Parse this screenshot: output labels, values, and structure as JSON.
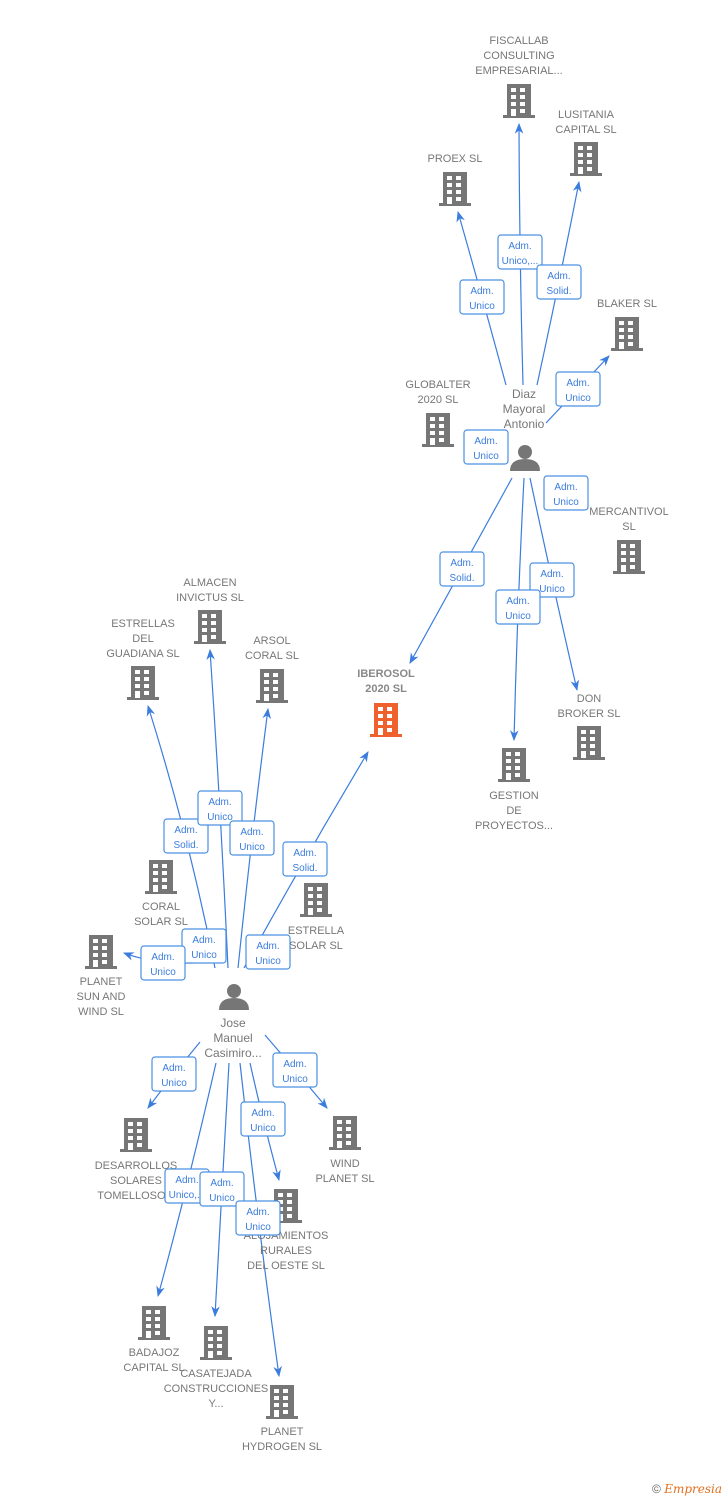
{
  "colors": {
    "edge": "#3b7ddd",
    "node": "#767676",
    "highlight": "#f0622d"
  },
  "hubs": [
    {
      "id": "diaz",
      "name": [
        "Diaz",
        "Mayoral",
        "Antonio"
      ],
      "icon": "person-icon"
    },
    {
      "id": "jose",
      "name": [
        "Jose",
        "Manuel",
        "Casimiro..."
      ],
      "icon": "person-icon"
    }
  ],
  "companies": [
    {
      "id": "fiscallab",
      "name": [
        "FISCALLAB",
        "CONSULTING",
        "EMPRESARIAL..."
      ]
    },
    {
      "id": "lusitania",
      "name": [
        "LUSITANIA",
        "CAPITAL  SL"
      ]
    },
    {
      "id": "proex",
      "name": [
        "PROEX  SL"
      ]
    },
    {
      "id": "blaker",
      "name": [
        "BLAKER  SL"
      ]
    },
    {
      "id": "globalter",
      "name": [
        "GLOBALTER",
        "2020  SL"
      ]
    },
    {
      "id": "mercantivol",
      "name": [
        "MERCANTIVOL",
        "SL"
      ]
    },
    {
      "id": "iberosol",
      "name": [
        "IBEROSOL",
        "2020  SL"
      ],
      "highlight": true
    },
    {
      "id": "donbroker",
      "name": [
        "DON",
        "BROKER  SL"
      ]
    },
    {
      "id": "gestion",
      "name": [
        "GESTION",
        "DE",
        "PROYECTOS..."
      ]
    },
    {
      "id": "almacen",
      "name": [
        "ALMACEN",
        "INVICTUS  SL"
      ]
    },
    {
      "id": "estrellas",
      "name": [
        "ESTRELLAS",
        "DEL",
        "GUADIANA  SL"
      ]
    },
    {
      "id": "arsol",
      "name": [
        "ARSOL",
        "CORAL  SL"
      ]
    },
    {
      "id": "coral",
      "name": [
        "CORAL",
        "SOLAR  SL"
      ]
    },
    {
      "id": "estrella",
      "name": [
        "ESTRELLA",
        "SOLAR  SL"
      ]
    },
    {
      "id": "planetsun",
      "name": [
        "PLANET",
        "SUN AND",
        "WIND  SL"
      ]
    },
    {
      "id": "desarrollos",
      "name": [
        "DESARROLLOS",
        "SOLARES",
        "TOMELLOSO..."
      ]
    },
    {
      "id": "wind",
      "name": [
        "WIND",
        "PLANET  SL"
      ]
    },
    {
      "id": "alojamientos",
      "name": [
        "ALOJAMIENTOS",
        "RURALES",
        "DEL OESTE SL"
      ]
    },
    {
      "id": "badajoz",
      "name": [
        "BADAJOZ",
        "CAPITAL  SL"
      ]
    },
    {
      "id": "casatejada",
      "name": [
        "CASATEJADA",
        "CONSTRUCCIONES",
        "Y..."
      ]
    },
    {
      "id": "hydrogen",
      "name": [
        "PLANET",
        "HYDROGEN  SL"
      ]
    }
  ],
  "edges": [
    {
      "from": "diaz",
      "to": "proex",
      "label": [
        "Adm.",
        "Unico"
      ]
    },
    {
      "from": "diaz",
      "to": "fiscallab",
      "label": [
        "Adm.",
        "Unico,..."
      ]
    },
    {
      "from": "diaz",
      "to": "lusitania",
      "label": [
        "Adm.",
        "Solid."
      ]
    },
    {
      "from": "diaz",
      "to": "blaker",
      "label": [
        "Adm.",
        "Unico"
      ]
    },
    {
      "from": "diaz",
      "to": "globalter",
      "label": [
        "Adm.",
        "Unico"
      ]
    },
    {
      "from": "diaz",
      "to": "mercantivol",
      "label": [
        "Adm.",
        "Unico"
      ]
    },
    {
      "from": "diaz",
      "to": "iberosol",
      "label": [
        "Adm.",
        "Solid."
      ]
    },
    {
      "from": "diaz",
      "to": "donbroker",
      "label": [
        "Adm.",
        "Unico"
      ]
    },
    {
      "from": "diaz",
      "to": "gestion",
      "label": [
        "Adm.",
        "Unico"
      ]
    },
    {
      "from": "jose",
      "to": "estrellas",
      "label": [
        "Adm.",
        "Solid."
      ]
    },
    {
      "from": "jose",
      "to": "almacen",
      "label": [
        "Adm.",
        "Unico"
      ]
    },
    {
      "from": "jose",
      "to": "arsol",
      "label": [
        "Adm.",
        "Unico"
      ]
    },
    {
      "from": "jose",
      "to": "iberosol",
      "label": [
        "Adm.",
        "Solid."
      ]
    },
    {
      "from": "jose",
      "to": "coral",
      "label": [
        "Adm.",
        "Unico"
      ]
    },
    {
      "from": "jose",
      "to": "estrella",
      "label": [
        "Adm.",
        "Unico"
      ]
    },
    {
      "from": "jose",
      "to": "planetsun",
      "label": [
        "Adm.",
        "Unico"
      ]
    },
    {
      "from": "jose",
      "to": "desarrollos",
      "label": [
        "Adm.",
        "Unico"
      ]
    },
    {
      "from": "jose",
      "to": "wind",
      "label": [
        "Adm.",
        "Unico"
      ]
    },
    {
      "from": "jose",
      "to": "alojamientos",
      "label": [
        "Adm.",
        "Unico"
      ]
    },
    {
      "from": "jose",
      "to": "badajoz",
      "label": [
        "Adm.",
        "Unico,..."
      ]
    },
    {
      "from": "jose",
      "to": "casatejada",
      "label": [
        "Adm.",
        "Unico"
      ]
    },
    {
      "from": "jose",
      "to": "hydrogen",
      "label": [
        "Adm.",
        "Unico"
      ]
    }
  ],
  "footer": {
    "copyright": "©",
    "brand": "Empresia"
  }
}
